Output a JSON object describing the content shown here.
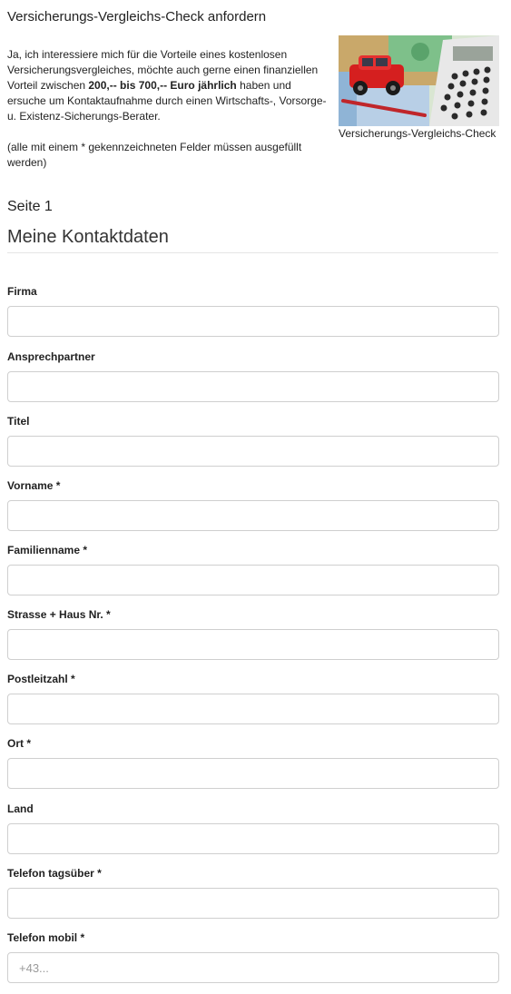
{
  "header": {
    "title": "Versicherungs-Vergleichs-Check anfordern",
    "intro_before": "Ja, ich interessiere mich für die Vorteile eines kostenlosen Versicherungsvergleiches, möchte auch gerne einen finanziellen Vorteil zwischen ",
    "intro_bold": "200,-- bis 700,-- Euro jährlich",
    "intro_after": " haben und ersuche um Kontaktaufnahme durch einen Wirtschafts-, Vorsorge- u. Existenz-Sicherungs-Berater.",
    "required_note": "(alle mit einem * gekennzeichneten Felder müssen ausgefüllt werden)",
    "image_caption": "Versicherungs-Vergleichs-Check"
  },
  "form": {
    "page_label": "Seite 1",
    "section_title": "Meine Kontaktdaten",
    "fields": [
      {
        "label": "Firma",
        "value": "",
        "placeholder": ""
      },
      {
        "label": "Ansprechpartner",
        "value": "",
        "placeholder": ""
      },
      {
        "label": "Titel",
        "value": "",
        "placeholder": ""
      },
      {
        "label": "Vorname *",
        "value": "",
        "placeholder": ""
      },
      {
        "label": "Familienname *",
        "value": "",
        "placeholder": ""
      },
      {
        "label": "Strasse + Haus Nr. *",
        "value": "",
        "placeholder": ""
      },
      {
        "label": "Postleitzahl *",
        "value": "",
        "placeholder": ""
      },
      {
        "label": "Ort *",
        "value": "",
        "placeholder": ""
      },
      {
        "label": "Land",
        "value": "",
        "placeholder": ""
      },
      {
        "label": "Telefon tagsüber *",
        "value": "",
        "placeholder": ""
      },
      {
        "label": "Telefon mobil *",
        "value": "",
        "placeholder": "+43..."
      }
    ]
  },
  "colors": {
    "text": "#222222",
    "input_border": "#cfcfcf",
    "divider": "#e5e5e5"
  }
}
